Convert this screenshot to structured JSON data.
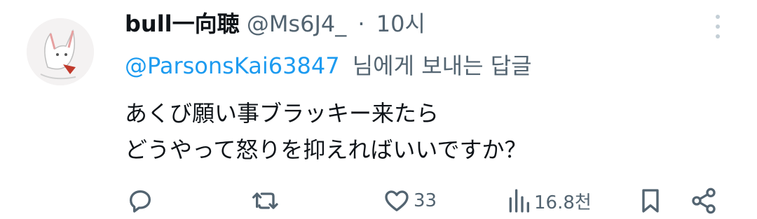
{
  "tweet": {
    "display_name": "bull一向聴",
    "handle": "@Ms6J4_",
    "separator": "·",
    "time": "10시",
    "reply_to": "@ParsonsKai63847",
    "reply_suffix": "님에게 보내는 답글",
    "body_lines": [
      "あくび願い事ブラッキー来たら",
      "どうやって怒りを抑えればいいですか？"
    ]
  },
  "actions": {
    "reply": {
      "icon": "reply-icon",
      "count": ""
    },
    "retweet": {
      "icon": "retweet-icon",
      "count": ""
    },
    "like": {
      "icon": "heart-icon",
      "count": "33"
    },
    "views": {
      "icon": "views-icon",
      "count": "16.8천"
    },
    "bookmark": {
      "icon": "bookmark-icon"
    },
    "share": {
      "icon": "share-icon"
    }
  },
  "colors": {
    "text": "#0f1419",
    "secondary": "#536471",
    "link": "#1d9bf0",
    "background": "#ffffff"
  }
}
